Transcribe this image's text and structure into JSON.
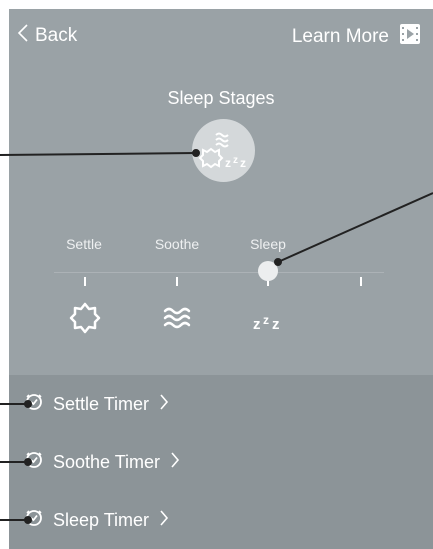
{
  "topbar": {
    "back_label": "Back",
    "learn_more_label": "Learn More",
    "back_icon": "chevron-left-icon",
    "learn_more_icon": "video-icon"
  },
  "page": {
    "title": "Sleep Stages",
    "hero_icon": "sleep-stages-icon"
  },
  "stages": [
    {
      "label": "Settle",
      "icon": "sun-icon"
    },
    {
      "label": "Soothe",
      "icon": "waves-icon"
    },
    {
      "label": "Sleep",
      "icon": "zzz-icon"
    },
    {
      "label": "",
      "icon": ""
    }
  ],
  "slider": {
    "selected_stage": "Sleep"
  },
  "timers": [
    {
      "label": "Settle Timer",
      "icon": "clock-icon"
    },
    {
      "label": "Soothe Timer",
      "icon": "clock-icon"
    },
    {
      "label": "Sleep Timer",
      "icon": "clock-icon"
    }
  ],
  "colors": {
    "top_bg": "#9aa2a6",
    "bottom_bg": "#8c9498",
    "text": "#ffffff",
    "callout": "#222222"
  }
}
